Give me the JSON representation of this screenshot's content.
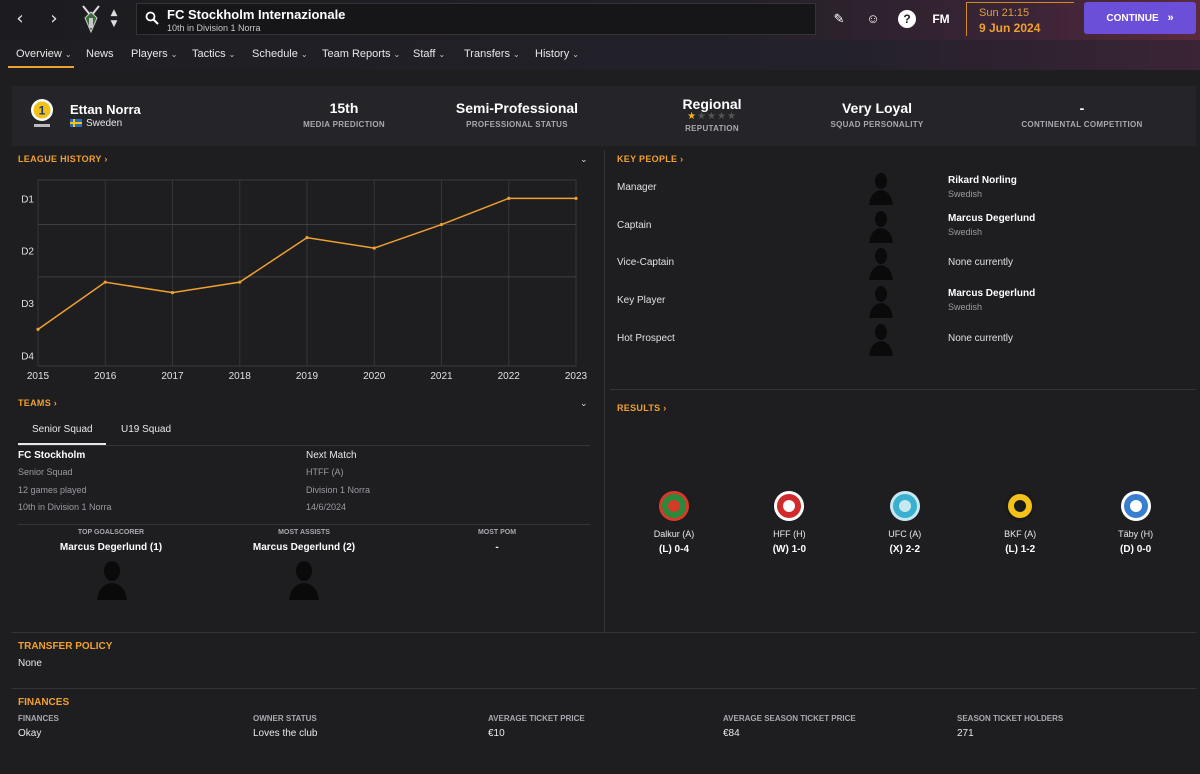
{
  "club": {
    "name": "FC Stockholm Internazionale",
    "subtitle": "10th in Division 1 Norra"
  },
  "datetime": {
    "time": "Sun 21:15",
    "date": "9 Jun 2024"
  },
  "continue_label": "CONTINUE",
  "fm_label": "FM",
  "help_label": "?",
  "tabs": [
    "Overview",
    "News",
    "Players",
    "Tactics",
    "Schedule",
    "Team Reports",
    "Staff",
    "Transfers",
    "History"
  ],
  "summary": {
    "league": "Ettan Norra",
    "country": "Sweden",
    "stats": [
      {
        "value": "15th",
        "label": "MEDIA PREDICTION"
      },
      {
        "value": "Semi-Professional",
        "label": "PROFESSIONAL STATUS"
      },
      {
        "value": "Regional",
        "label": "REPUTATION",
        "stars": 1,
        "stars_max": 5
      },
      {
        "value": "Very Loyal",
        "label": "SQUAD PERSONALITY"
      },
      {
        "value": "-",
        "label": "CONTINENTAL COMPETITION"
      }
    ]
  },
  "sections": {
    "league_history": "LEAGUE HISTORY",
    "key_people": "KEY PEOPLE",
    "teams": "TEAMS",
    "results": "RESULTS",
    "transfer_policy": "TRANSFER POLICY",
    "finances": "FINANCES"
  },
  "chart_data": {
    "type": "line",
    "x": [
      2015,
      2016,
      2017,
      2018,
      2019,
      2020,
      2021,
      2022,
      2023
    ],
    "series": [
      {
        "values": [
          3.5,
          2.6,
          2.8,
          2.6,
          1.75,
          1.95,
          1.5,
          1.0,
          1.0
        ]
      }
    ],
    "yticks": [
      "D1",
      "D2",
      "D3",
      "D4"
    ],
    "ylim": [
      1,
      4
    ],
    "line_color": "#f0a030",
    "grid": true
  },
  "key_people": [
    {
      "role": "Manager",
      "name": "Rikard Norling",
      "nationality": "Swedish"
    },
    {
      "role": "Captain",
      "name": "Marcus Degerlund",
      "nationality": "Swedish"
    },
    {
      "role": "Vice-Captain",
      "name": "",
      "nationality": "",
      "none": "None currently"
    },
    {
      "role": "Key Player",
      "name": "Marcus Degerlund",
      "nationality": "Swedish"
    },
    {
      "role": "Hot Prospect",
      "name": "",
      "nationality": "",
      "none": "None currently"
    }
  ],
  "teams": {
    "tabs": [
      "Senior Squad",
      "U19 Squad"
    ],
    "club_short": "FC Stockholm",
    "squad": "Senior Squad",
    "games_played": "12 games played",
    "position": "10th in Division 1 Norra",
    "next_match_label": "Next Match",
    "next_opponent": "HTFF (A)",
    "next_competition": "Division 1 Norra",
    "next_date": "14/6/2024",
    "performers": [
      {
        "label": "TOP GOALSCORER",
        "value": "Marcus Degerlund (1)",
        "has_photo": true
      },
      {
        "label": "MOST ASSISTS",
        "value": "Marcus Degerlund (2)",
        "has_photo": true
      },
      {
        "label": "MOST POM",
        "value": "-",
        "has_photo": false
      }
    ]
  },
  "results": [
    {
      "opponent": "Dalkur (A)",
      "score": "(L) 0-4",
      "colors": [
        "#2a8a3a",
        "#d63a2a"
      ]
    },
    {
      "opponent": "HFF (H)",
      "score": "(W) 1-0",
      "colors": [
        "#d02a2a",
        "#ffffff"
      ]
    },
    {
      "opponent": "UFC (A)",
      "score": "(X) 2-2",
      "colors": [
        "#3ab0d0",
        "#c8e8f0"
      ]
    },
    {
      "opponent": "BKF (A)",
      "score": "(L) 1-2",
      "colors": [
        "#f2c21a",
        "#1a1a1a"
      ]
    },
    {
      "opponent": "Täby (H)",
      "score": "(D) 0-0",
      "colors": [
        "#3a7ed0",
        "#ffffff"
      ]
    }
  ],
  "transfer_policy": "None",
  "finances": [
    {
      "label": "FINANCES",
      "value": "Okay"
    },
    {
      "label": "OWNER STATUS",
      "value": "Loves the club"
    },
    {
      "label": "AVERAGE TICKET PRICE",
      "value": "€10"
    },
    {
      "label": "AVERAGE SEASON TICKET PRICE",
      "value": "€84"
    },
    {
      "label": "SEASON TICKET HOLDERS",
      "value": "271"
    }
  ]
}
